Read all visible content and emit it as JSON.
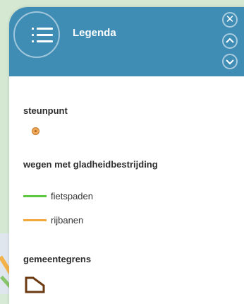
{
  "header": {
    "title": "Legenda",
    "menu_icon": "hamburger-icon",
    "close_icon": "close-icon",
    "up_icon": "chevron-up-icon",
    "down_icon": "chevron-down-icon",
    "color": "#3f8db5"
  },
  "legend": {
    "steunpunt": {
      "title": "steunpunt",
      "icon": "point-marker-icon",
      "color": "#f0a858"
    },
    "wegen": {
      "title": "wegen met gladheidbestrijding",
      "items": [
        {
          "label": "fietspaden",
          "color": "#5cc83f"
        },
        {
          "label": "rijbanen",
          "color": "#f2a93b"
        }
      ]
    },
    "gemeentegrens": {
      "title": "gemeentegrens",
      "icon": "boundary-polygon-icon",
      "color": "#6b3a12"
    }
  }
}
